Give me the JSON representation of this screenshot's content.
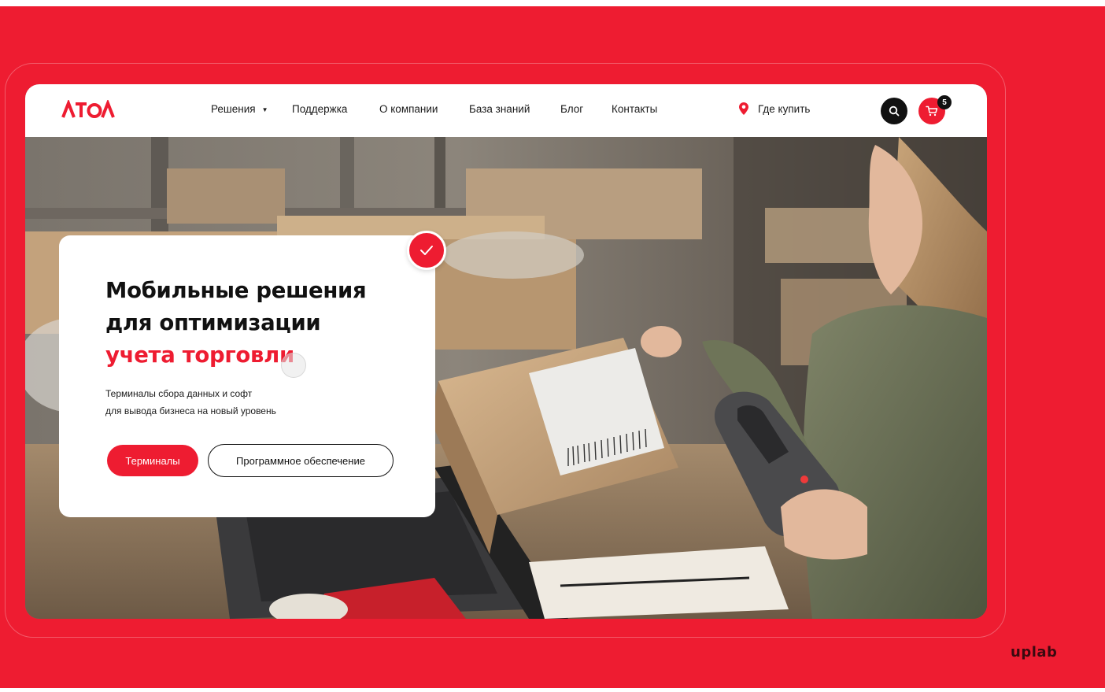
{
  "footer_brand": "uplab",
  "header": {
    "logo": "ATOΛ",
    "nav": [
      {
        "label": "Решения",
        "has_dropdown": true
      },
      {
        "label": "Поддержка"
      },
      {
        "label": "О компании"
      },
      {
        "label": "База знаний"
      },
      {
        "label": "Блог"
      },
      {
        "label": "Контакты"
      }
    ],
    "where_to_buy": "Где купить",
    "cart_count": "5"
  },
  "hero": {
    "title_line1": "Мобильные решения",
    "title_line2": "для оптимизации",
    "title_accent": "учета торговли",
    "subtitle_line1": "Терминалы сбора данных и софт",
    "subtitle_line2": "для вывода бизнеса на новый уровень",
    "primary_button": "Терминалы",
    "secondary_button": "Программное обеспечение"
  },
  "colors": {
    "brand_red": "#ee1c31",
    "dark": "#111111",
    "white": "#ffffff"
  }
}
